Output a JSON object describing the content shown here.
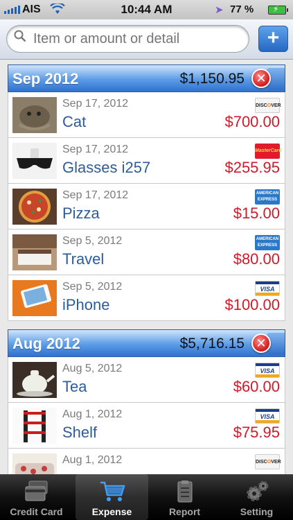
{
  "status_bar": {
    "carrier": "AIS",
    "time": "10:44 AM",
    "battery": "77 %"
  },
  "search": {
    "placeholder": "Item or amount or detail",
    "add_label": "+"
  },
  "sections": [
    {
      "title": "Sep 2012",
      "total": "$1,150.95",
      "items": [
        {
          "date": "Sep 17, 2012",
          "name": "Cat",
          "amount": "$700.00",
          "card": "discover-logo",
          "thumb": "cat-photo"
        },
        {
          "date": "Sep 17, 2012",
          "name": "Glasses i257",
          "amount": "$255.95",
          "card": "mastercard-logo",
          "thumb": "glasses-photo"
        },
        {
          "date": "Sep 17, 2012",
          "name": "Pizza",
          "amount": "$15.00",
          "card": "amex-logo",
          "thumb": "pizza-photo"
        },
        {
          "date": "Sep 5, 2012",
          "name": "Travel",
          "amount": "$80.00",
          "card": "amex-logo",
          "thumb": "hotel-room-photo"
        },
        {
          "date": "Sep 5, 2012",
          "name": "iPhone",
          "amount": "$100.00",
          "card": "visa-logo",
          "thumb": "iphone-photo"
        }
      ]
    },
    {
      "title": "Aug 2012",
      "total": "$5,716.15",
      "items": [
        {
          "date": "Aug 5, 2012",
          "name": "Tea",
          "amount": "$60.00",
          "card": "visa-logo",
          "thumb": "teapot-photo"
        },
        {
          "date": "Aug 1, 2012",
          "name": "Shelf",
          "amount": "$75.95",
          "card": "visa-logo",
          "thumb": "shelf-photo"
        },
        {
          "date": "Aug 1, 2012",
          "name": "",
          "amount": "",
          "card": "discover-logo",
          "thumb": "sofa-photo"
        }
      ]
    }
  ],
  "card_logo_text": {
    "discover": "DISCOVER",
    "mastercard": "MasterCard",
    "amex": "AMERICAN EXPRESS",
    "visa": "VISA"
  },
  "tabs": [
    {
      "label": "Credit Card",
      "icon": "credit-card-icon",
      "active": false
    },
    {
      "label": "Expense",
      "icon": "shopping-cart-icon",
      "active": true
    },
    {
      "label": "Report",
      "icon": "report-icon",
      "active": false
    },
    {
      "label": "Setting",
      "icon": "gears-icon",
      "active": false
    }
  ],
  "colors": {
    "accent_blue": "#2f72cf",
    "amount_red": "#d01a2a",
    "name_blue": "#2d5c98",
    "delete_red": "#d11a1a"
  }
}
